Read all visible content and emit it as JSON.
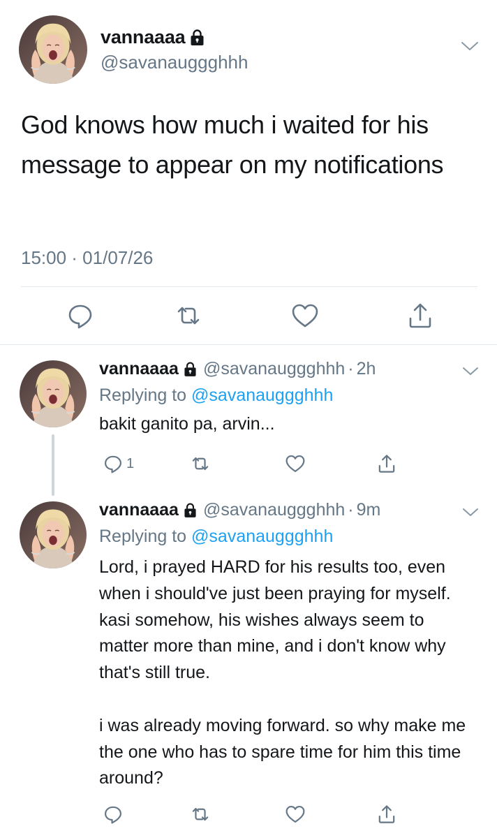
{
  "colors": {
    "text": "#14171a",
    "secondary": "#657786",
    "link": "#1da1f2",
    "divider": "#e1e8ed",
    "thread_line": "#ccd6dd"
  },
  "main_tweet": {
    "display_name": "vannaaaa",
    "handle": "@savanauggghhh",
    "protected_icon": "lock-icon",
    "text": "God knows how much i waited for his message to appear on my notifications",
    "timestamp": "15:00 · 01/07/26",
    "actions": [
      "reply-icon",
      "retweet-icon",
      "like-icon",
      "share-icon"
    ]
  },
  "replies": [
    {
      "display_name": "vannaaaa",
      "handle": "@savanauggghhh",
      "dot": "·",
      "time": "2h",
      "replying_prefix": "Replying to",
      "replying_to": "@savanauggghhh",
      "paragraphs": [
        "bakit ganito pa, arvin..."
      ],
      "reply_count": "1"
    },
    {
      "display_name": "vannaaaa",
      "handle": "@savanauggghhh",
      "dot": "·",
      "time": "9m",
      "replying_prefix": "Replying to",
      "replying_to": "@savanauggghhh",
      "paragraphs": [
        "Lord, i prayed HARD for his results too, even when i should've just been praying for myself. kasi somehow, his wishes always seem to matter more than mine, and i don't know why that's still true.",
        "i was already moving forward. so why make me the one who has to spare time for him this time around?"
      ],
      "reply_count": ""
    }
  ]
}
